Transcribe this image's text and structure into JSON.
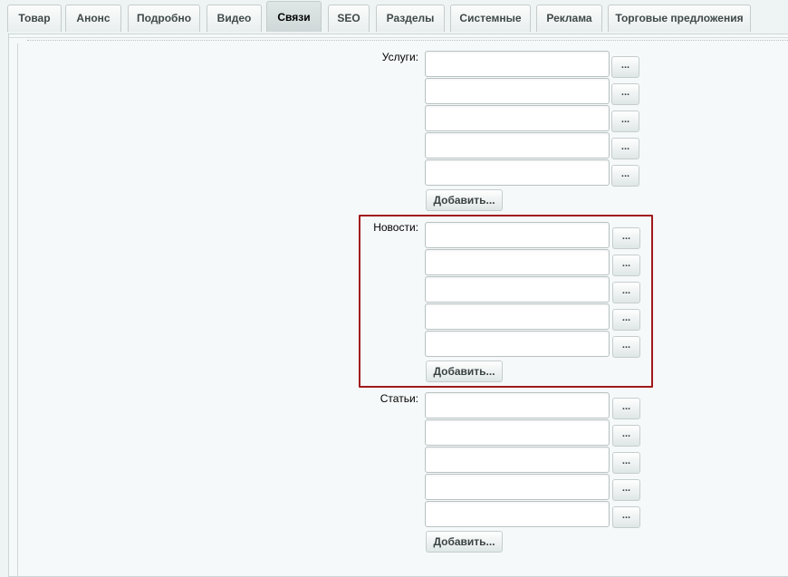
{
  "tabs": [
    {
      "label": "Товар"
    },
    {
      "label": "Анонс"
    },
    {
      "label": "Подробно"
    },
    {
      "label": "Видео"
    },
    {
      "label": "Связи"
    },
    {
      "label": "SEO"
    },
    {
      "label": "Разделы"
    },
    {
      "label": "Системные"
    },
    {
      "label": "Реклама"
    },
    {
      "label": "Торговые предложения"
    }
  ],
  "active_tab": "Связи",
  "sections": [
    {
      "label": "Услуги:",
      "fields": [
        "",
        "",
        "",
        "",
        ""
      ],
      "browse_label": "...",
      "add_label": "Добавить..."
    },
    {
      "label": "Новости:",
      "fields": [
        "",
        "",
        "",
        "",
        ""
      ],
      "browse_label": "...",
      "add_label": "Добавить..."
    },
    {
      "label": "Статьи:",
      "fields": [
        "",
        "",
        "",
        "",
        ""
      ],
      "browse_label": "...",
      "add_label": "Добавить..."
    }
  ],
  "highlight_color": "#a01a1a"
}
